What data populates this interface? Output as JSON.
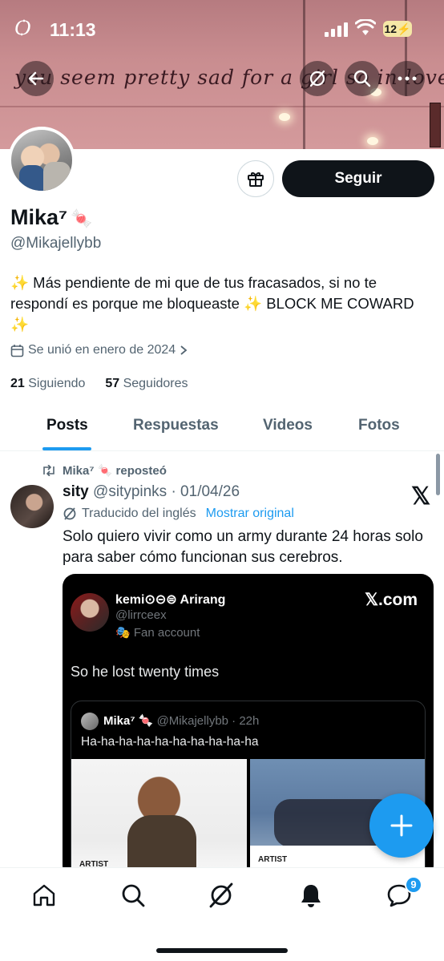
{
  "status_bar": {
    "logo": "Ѻ",
    "time": "11:13",
    "battery": "12"
  },
  "banner": {
    "scribble_text": "you seem pretty sad for a girl so in love"
  },
  "profile": {
    "follow_label": "Seguir",
    "name": "Mika⁷",
    "name_emoji": "🍬",
    "handle": "@Mikajellybb",
    "bio": "✨ Más pendiente de mi que de tus fracasados, si no te respondí es porque me bloqueaste ✨ BLOCK ME COWARD ✨",
    "joined": "Se unió en enero de 2024",
    "following_count": "21",
    "following_label": "Siguiendo",
    "followers_count": "57",
    "followers_label": "Seguidores"
  },
  "tabs": [
    {
      "label": "Posts",
      "active": true
    },
    {
      "label": "Respuestas",
      "active": false
    },
    {
      "label": "Videos",
      "active": false
    },
    {
      "label": "Fotos",
      "active": false
    }
  ],
  "post": {
    "repost_by": "Mika⁷ 🍬 reposteó",
    "author": "sity",
    "handle_date": "@sitypinks · 01/04/26",
    "translated": "Traducido del inglés",
    "show_original": "Mostrar original",
    "text": "Solo quiero vivir como un army durante 24 horas solo para saber cómo funcionan sus cerebros.",
    "embed": {
      "name": "kemi⊙⊝⊜ Arirang",
      "handle": "@lirrceex",
      "fan": "Fan account",
      "brand": "𝕏.com",
      "text": "So he lost twenty times",
      "quote": {
        "name": "Mika⁷",
        "handle_time": "@Mikajellybb · 22h",
        "text": "Ha-ha-ha-ha-ha-ha-ha-ha-ha-ha",
        "label_left": "ARTIST",
        "label_right": "ARTIST"
      }
    }
  },
  "notifications_badge": "9",
  "accent_color": "#1d9bf0"
}
